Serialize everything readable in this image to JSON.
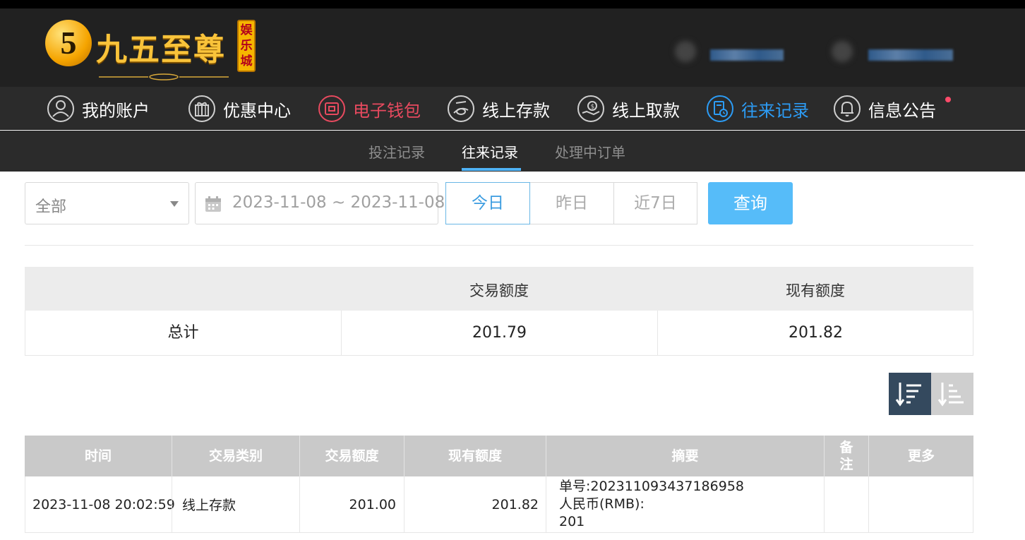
{
  "header": {
    "logo_number": "5",
    "logo_text": "九五至尊",
    "logo_tag": [
      "娱",
      "乐",
      "城"
    ]
  },
  "nav": {
    "items": [
      {
        "label": "我的账户",
        "icon": "user-icon"
      },
      {
        "label": "优惠中心",
        "icon": "gift-icon"
      },
      {
        "label": "电子钱包",
        "icon": "wallet-icon"
      },
      {
        "label": "线上存款",
        "icon": "deposit-icon"
      },
      {
        "label": "线上取款",
        "icon": "withdraw-icon"
      },
      {
        "label": "往来记录",
        "icon": "records-icon"
      },
      {
        "label": "信息公告",
        "icon": "bell-icon"
      }
    ],
    "active": "往来记录",
    "wallet_color": "#e84a5f",
    "active_color": "#2c9cf5"
  },
  "subnav": {
    "items": [
      "投注记录",
      "往来记录",
      "处理中订单"
    ],
    "active": "往来记录"
  },
  "filters": {
    "type_select": "全部",
    "date_range": "2023-11-08 ~ 2023-11-08",
    "quick": [
      "今日",
      "昨日",
      "近7日"
    ],
    "quick_active": "今日",
    "query_label": "查询"
  },
  "summary": {
    "headers": [
      "",
      "交易额度",
      "现有额度"
    ],
    "total_label": "总计",
    "transaction_amount": "201.79",
    "current_balance": "201.82"
  },
  "records": {
    "headers": [
      "时间",
      "交易类别",
      "交易额度",
      "现有额度",
      "摘要",
      "备\n注",
      "更多"
    ],
    "rows": [
      {
        "time": "2023-11-08 20:02:59",
        "type": "线上存款",
        "amount": "201.00",
        "balance": "201.82",
        "summary": [
          "单号:202311093437186958",
          "人民币(RMB):",
          "201"
        ],
        "note": "",
        "more": ""
      }
    ]
  }
}
